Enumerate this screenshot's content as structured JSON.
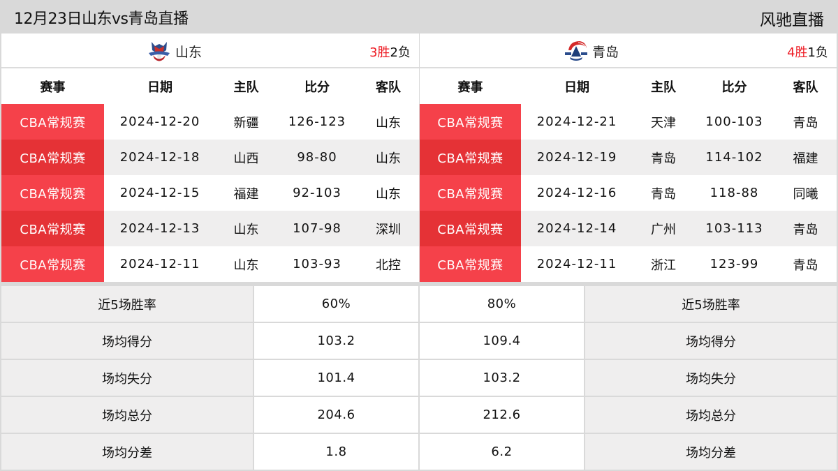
{
  "header": {
    "title": "12月23日山东vs青岛直播",
    "brand": "风驰直播"
  },
  "colors": {
    "accent_red": "#f5414a",
    "accent_red_dark": "#e53236",
    "win_red": "#ee1c25"
  },
  "columns": [
    "赛事",
    "日期",
    "主队",
    "比分",
    "客队"
  ],
  "left_team": {
    "name": "山东",
    "logo_icon": "shandong-logo-icon",
    "record": {
      "wins": "3",
      "wins_label": "胜",
      "losses": "2",
      "losses_label": "负"
    },
    "games": [
      {
        "league": "CBA常规赛",
        "date": "2024-12-20",
        "home": "新疆",
        "score": "126-123",
        "away": "山东"
      },
      {
        "league": "CBA常规赛",
        "date": "2024-12-18",
        "home": "山西",
        "score": "98-80",
        "away": "山东"
      },
      {
        "league": "CBA常规赛",
        "date": "2024-12-15",
        "home": "福建",
        "score": "92-103",
        "away": "山东"
      },
      {
        "league": "CBA常规赛",
        "date": "2024-12-13",
        "home": "山东",
        "score": "107-98",
        "away": "深圳"
      },
      {
        "league": "CBA常规赛",
        "date": "2024-12-11",
        "home": "山东",
        "score": "103-93",
        "away": "北控"
      }
    ]
  },
  "right_team": {
    "name": "青岛",
    "logo_icon": "qingdao-logo-icon",
    "record": {
      "wins": "4",
      "wins_label": "胜",
      "losses": "1",
      "losses_label": "负"
    },
    "games": [
      {
        "league": "CBA常规赛",
        "date": "2024-12-21",
        "home": "天津",
        "score": "100-103",
        "away": "青岛"
      },
      {
        "league": "CBA常规赛",
        "date": "2024-12-19",
        "home": "青岛",
        "score": "114-102",
        "away": "福建"
      },
      {
        "league": "CBA常规赛",
        "date": "2024-12-16",
        "home": "青岛",
        "score": "118-88",
        "away": "同曦"
      },
      {
        "league": "CBA常规赛",
        "date": "2024-12-14",
        "home": "广州",
        "score": "103-113",
        "away": "青岛"
      },
      {
        "league": "CBA常规赛",
        "date": "2024-12-11",
        "home": "浙江",
        "score": "123-99",
        "away": "青岛"
      }
    ]
  },
  "stats": [
    {
      "label": "近5场胜率",
      "left": "60%",
      "right": "80%"
    },
    {
      "label": "场均得分",
      "left": "103.2",
      "right": "109.4"
    },
    {
      "label": "场均失分",
      "left": "101.4",
      "right": "103.2"
    },
    {
      "label": "场均总分",
      "left": "204.6",
      "right": "212.6"
    },
    {
      "label": "场均分差",
      "left": "1.8",
      "right": "6.2"
    }
  ]
}
